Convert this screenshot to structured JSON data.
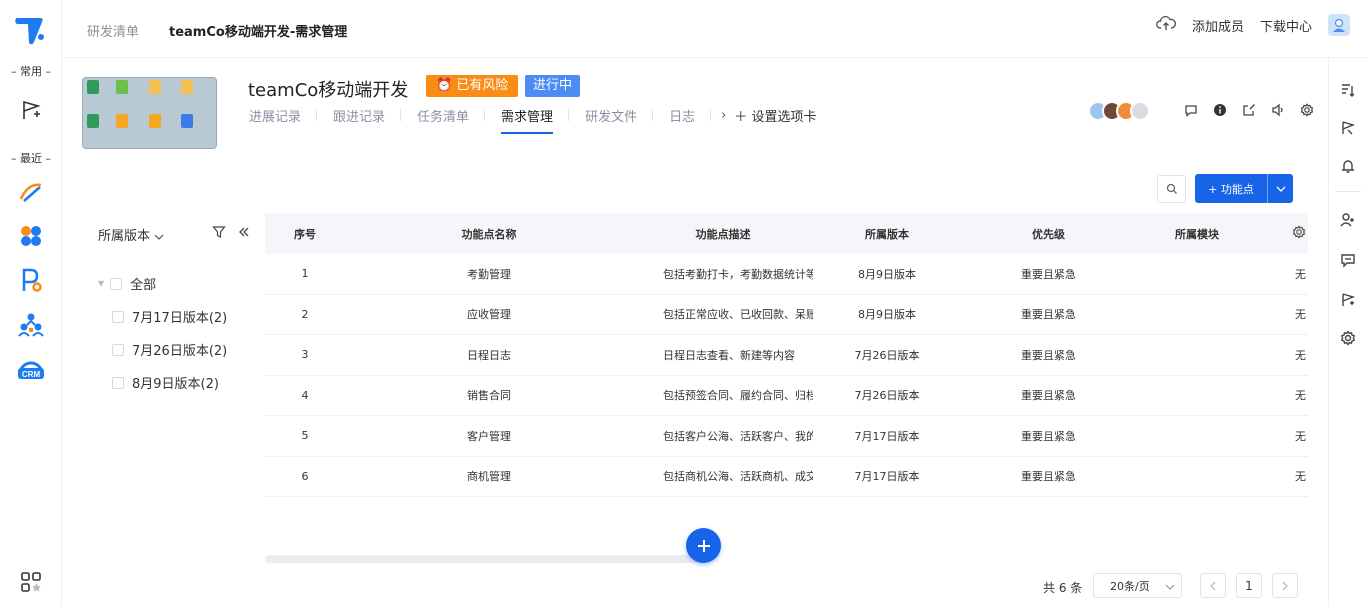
{
  "rail": {
    "section_common": "– 常用 –",
    "section_recent": "– 最近 –"
  },
  "breadcrumb": {
    "first": "研发清单",
    "current": "teamCo移动端开发-需求管理"
  },
  "top_actions": {
    "add_member": "添加成员",
    "download_center": "下载中心"
  },
  "project": {
    "title": "teamCo移动端开发",
    "risk_tag": "已有风险",
    "status_tag": "进行中"
  },
  "tabs": [
    {
      "label": "进展记录"
    },
    {
      "label": "跟进记录"
    },
    {
      "label": "任务清单"
    },
    {
      "label": "需求管理"
    },
    {
      "label": "研发文件"
    },
    {
      "label": "日志"
    }
  ],
  "tab_settings_label": "设置选项卡",
  "toolbar": {
    "add_label": "+ 功能点"
  },
  "filter": {
    "title": "所属版本",
    "tree": [
      {
        "label": "全部"
      },
      {
        "label": "7月17日版本(2)"
      },
      {
        "label": "7月26日版本(2)"
      },
      {
        "label": "8月9日版本(2)"
      }
    ]
  },
  "table": {
    "columns": [
      "序号",
      "功能点名称",
      "功能点描述",
      "所属版本",
      "优先级",
      "所属模块"
    ],
    "rows": [
      {
        "no": "1",
        "name": "考勤管理",
        "desc": "包括考勤打卡，考勤数据统计等",
        "version": "8月9日版本",
        "priority": "重要且紧急",
        "module": "无"
      },
      {
        "no": "2",
        "name": "应收管理",
        "desc": "包括正常应收、已收回款、呆账...",
        "version": "8月9日版本",
        "priority": "重要且紧急",
        "module": "无"
      },
      {
        "no": "3",
        "name": "日程日志",
        "desc": "日程日志查看、新建等内容",
        "version": "7月26日版本",
        "priority": "重要且紧急",
        "module": "无"
      },
      {
        "no": "4",
        "name": "销售合同",
        "desc": "包括预签合同、履约合同、归档...",
        "version": "7月26日版本",
        "priority": "重要且紧急",
        "module": "无"
      },
      {
        "no": "5",
        "name": "客户管理",
        "desc": "包括客户公海、活跃客户、我的...",
        "version": "7月17日版本",
        "priority": "重要且紧急",
        "module": "无"
      },
      {
        "no": "6",
        "name": "商机管理",
        "desc": "包括商机公海、活跃商机、成交...",
        "version": "7月17日版本",
        "priority": "重要且紧急",
        "module": "无"
      }
    ]
  },
  "pagination": {
    "total": "共 6 条",
    "page_size": "20条/页",
    "current_page": "1"
  },
  "colors": {
    "primary": "#1764e8",
    "risk": "#fa8c16",
    "status": "#4d8cf5"
  }
}
